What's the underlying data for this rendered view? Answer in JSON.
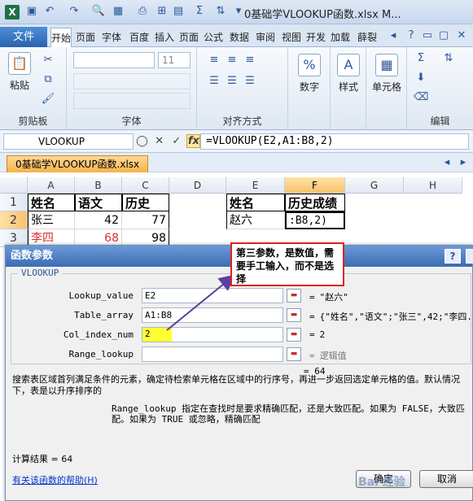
{
  "titlebar": {
    "app_icon": "X",
    "title": "0基础学VLOOKUP函数.xlsx M..."
  },
  "ribbon_tabs": [
    "开始",
    "页面",
    "字体",
    "百度",
    "插入",
    "页面",
    "公式",
    "数据",
    "审阅",
    "视图",
    "开发",
    "加载",
    "薛裂"
  ],
  "file_tab": "文件",
  "ribbon": {
    "paste_label": "粘贴",
    "clipboard_label": "剪贴板",
    "font_label": "字体",
    "font_size": "11",
    "align_label": "对齐方式",
    "number_label": "数字",
    "number_icon": "%",
    "style_label": "样式",
    "cell_label": "单元格",
    "edit_label": "编辑",
    "sigma_icon": "Σ"
  },
  "formula_bar": {
    "name_box": "VLOOKUP",
    "cancel": "✕",
    "enter": "✓",
    "fx": "fx",
    "formula": "=VLOOKUP(E2,A1:B8,2)"
  },
  "workbook_tab": "0基础学VLOOKUP函数.xlsx",
  "columns": [
    "A",
    "B",
    "C",
    "D",
    "E",
    "F",
    "G",
    "H"
  ],
  "rows": [
    "1",
    "2",
    "3"
  ],
  "cells": {
    "A1": "姓名",
    "B1": "语文",
    "C1": "历史",
    "A2": "张三",
    "B2": "42",
    "C2": "77",
    "A3": "李四",
    "B3": "68",
    "C3": "98",
    "E1": "姓名",
    "F1": "历史成绩",
    "E2": "赵六",
    "F2": ":B8,2)"
  },
  "dialog": {
    "title": "函数参数",
    "help": "?",
    "function_name": "VLOOKUP",
    "args": [
      {
        "label": "Lookup_value",
        "value": "E2",
        "result": "\"赵六\""
      },
      {
        "label": "Table_array",
        "value": "A1:B8",
        "result": "{\"姓名\",\"语文\";\"张三\",42;\"李四..."
      },
      {
        "label": "Col_index_num",
        "value": "2",
        "result": "2"
      },
      {
        "label": "Range_lookup",
        "value": "",
        "result": "逻辑值"
      }
    ],
    "equals": "=",
    "total": "64",
    "description": "搜索表区域首列满足条件的元素，确定待检索单元格在区域中的行序号，再进一步返回选定单元格的值。默认情况下，表是以升序排序的",
    "arg_description": "Range_lookup  指定在查找时是要求精确匹配，还是大致匹配。如果为 FALSE，大致匹配。如果为 TRUE 或忽略，精确匹配",
    "result_line": "计算结果 =  64",
    "help_link": "有关该函数的帮助(H)",
    "ok": "确定",
    "cancel": "取消"
  },
  "callout": "第三参数，是数值，需要手工输入，而不是选择",
  "watermark": "Bai 经验"
}
